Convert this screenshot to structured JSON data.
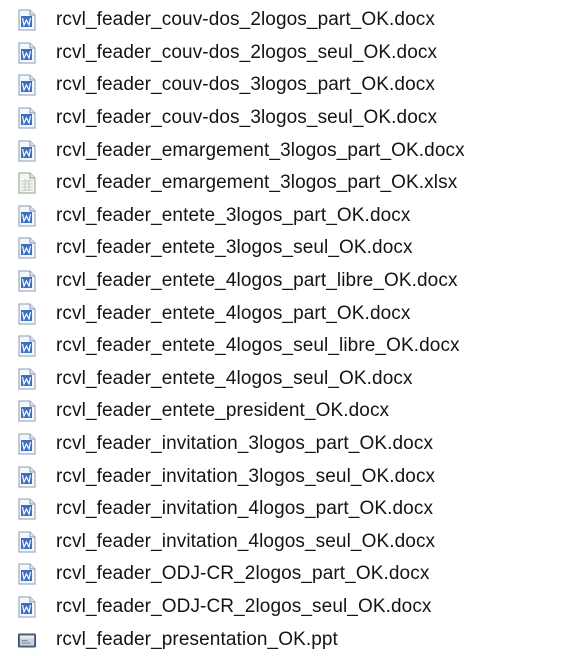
{
  "files": [
    {
      "name": "rcvl_feader_couv-dos_2logos_part_OK.docx",
      "icon": "word-document-icon"
    },
    {
      "name": "rcvl_feader_couv-dos_2logos_seul_OK.docx",
      "icon": "word-document-icon"
    },
    {
      "name": "rcvl_feader_couv-dos_3logos_part_OK.docx",
      "icon": "word-document-icon"
    },
    {
      "name": "rcvl_feader_couv-dos_3logos_seul_OK.docx",
      "icon": "word-document-icon"
    },
    {
      "name": "rcvl_feader_emargement_3logos_part_OK.docx",
      "icon": "word-document-icon"
    },
    {
      "name": "rcvl_feader_emargement_3logos_part_OK.xlsx",
      "icon": "excel-document-icon"
    },
    {
      "name": "rcvl_feader_entete_3logos_part_OK.docx",
      "icon": "word-document-icon"
    },
    {
      "name": "rcvl_feader_entete_3logos_seul_OK.docx",
      "icon": "word-document-icon"
    },
    {
      "name": "rcvl_feader_entete_4logos_part_libre_OK.docx",
      "icon": "word-document-icon"
    },
    {
      "name": "rcvl_feader_entete_4logos_part_OK.docx",
      "icon": "word-document-icon"
    },
    {
      "name": "rcvl_feader_entete_4logos_seul_libre_OK.docx",
      "icon": "word-document-icon"
    },
    {
      "name": "rcvl_feader_entete_4logos_seul_OK.docx",
      "icon": "word-document-icon"
    },
    {
      "name": "rcvl_feader_entete_president_OK.docx",
      "icon": "word-document-icon"
    },
    {
      "name": "rcvl_feader_invitation_3logos_part_OK.docx",
      "icon": "word-document-icon"
    },
    {
      "name": "rcvl_feader_invitation_3logos_seul_OK.docx",
      "icon": "word-document-icon"
    },
    {
      "name": "rcvl_feader_invitation_4logos_part_OK.docx",
      "icon": "word-document-icon"
    },
    {
      "name": "rcvl_feader_invitation_4logos_seul_OK.docx",
      "icon": "word-document-icon"
    },
    {
      "name": "rcvl_feader_ODJ-CR_2logos_part_OK.docx",
      "icon": "word-document-icon"
    },
    {
      "name": "rcvl_feader_ODJ-CR_2logos_seul_OK.docx",
      "icon": "word-document-icon"
    },
    {
      "name": "rcvl_feader_presentation_OK.ppt",
      "icon": "powerpoint-presentation-icon"
    }
  ]
}
